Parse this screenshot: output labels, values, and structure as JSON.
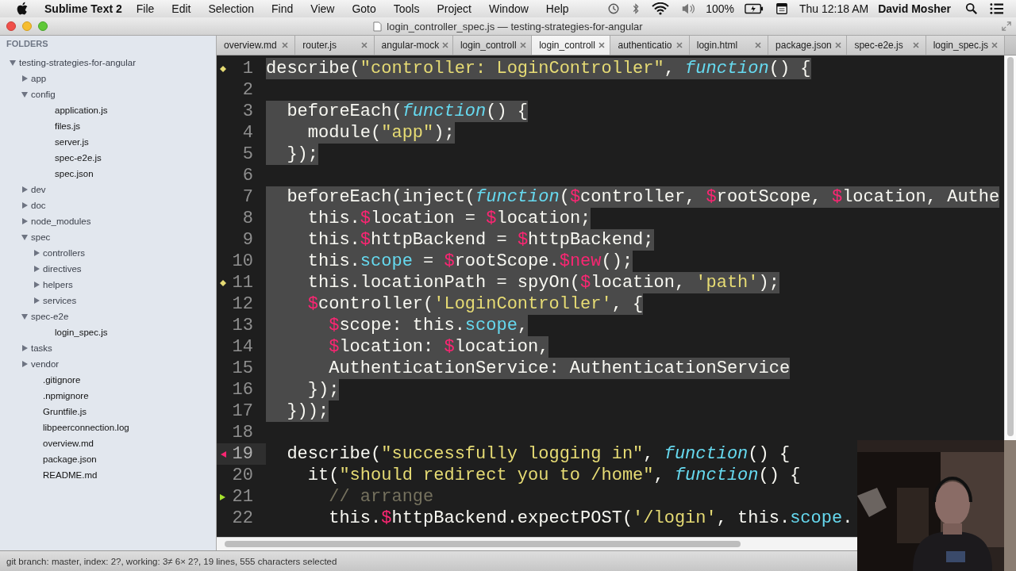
{
  "menubar": {
    "app": "Sublime Text 2",
    "menus": [
      "File",
      "Edit",
      "Selection",
      "Find",
      "View",
      "Goto",
      "Tools",
      "Project",
      "Window",
      "Help"
    ],
    "battery": "100%",
    "clock": "Thu 12:18 AM",
    "user": "David Mosher"
  },
  "window": {
    "title": "login_controller_spec.js — testing-strategies-for-angular"
  },
  "sidebar": {
    "header": "FOLDERS",
    "tree": [
      {
        "label": "testing-strategies-for-angular",
        "kind": "folder",
        "expanded": true,
        "children": [
          {
            "label": "app",
            "kind": "folder",
            "expanded": false
          },
          {
            "label": "config",
            "kind": "folder",
            "expanded": true,
            "children": [
              {
                "label": "application.js",
                "kind": "file"
              },
              {
                "label": "files.js",
                "kind": "file"
              },
              {
                "label": "server.js",
                "kind": "file"
              },
              {
                "label": "spec-e2e.js",
                "kind": "file"
              },
              {
                "label": "spec.json",
                "kind": "file"
              }
            ]
          },
          {
            "label": "dev",
            "kind": "folder",
            "expanded": false
          },
          {
            "label": "doc",
            "kind": "folder",
            "expanded": false
          },
          {
            "label": "node_modules",
            "kind": "folder",
            "expanded": false
          },
          {
            "label": "spec",
            "kind": "folder",
            "expanded": true,
            "children": [
              {
                "label": "controllers",
                "kind": "folder",
                "expanded": false
              },
              {
                "label": "directives",
                "kind": "folder",
                "expanded": false
              },
              {
                "label": "helpers",
                "kind": "folder",
                "expanded": false
              },
              {
                "label": "services",
                "kind": "folder",
                "expanded": false
              }
            ]
          },
          {
            "label": "spec-e2e",
            "kind": "folder",
            "expanded": true,
            "children": [
              {
                "label": "login_spec.js",
                "kind": "file"
              }
            ]
          },
          {
            "label": "tasks",
            "kind": "folder",
            "expanded": false
          },
          {
            "label": "vendor",
            "kind": "folder",
            "expanded": false
          },
          {
            "label": ".gitignore",
            "kind": "file"
          },
          {
            "label": ".npmignore",
            "kind": "file"
          },
          {
            "label": "Gruntfile.js",
            "kind": "file"
          },
          {
            "label": "libpeerconnection.log",
            "kind": "file"
          },
          {
            "label": "overview.md",
            "kind": "file"
          },
          {
            "label": "package.json",
            "kind": "file"
          },
          {
            "label": "README.md",
            "kind": "file"
          }
        ]
      }
    ]
  },
  "tabs": [
    {
      "label": "overview.md",
      "selected": false
    },
    {
      "label": "router.js",
      "selected": false
    },
    {
      "label": "angular-mock",
      "selected": false
    },
    {
      "label": "login_controll",
      "selected": false
    },
    {
      "label": "login_controll",
      "selected": true
    },
    {
      "label": "authenticatio",
      "selected": false
    },
    {
      "label": "login.html",
      "selected": false
    },
    {
      "label": "package.json",
      "selected": false
    },
    {
      "label": "spec-e2e.js",
      "selected": false
    },
    {
      "label": "login_spec.js",
      "selected": false
    }
  ],
  "editor": {
    "lines": [
      {
        "number": "1",
        "marker": {
          "kind": "modified"
        },
        "selected": true,
        "current": false,
        "tokens": [
          {
            "kind": "plain",
            "text": "describe("
          },
          {
            "kind": "str",
            "text": "\"controller: LoginController\""
          },
          {
            "kind": "plain",
            "text": ", "
          },
          {
            "kind": "fn",
            "text": "function"
          },
          {
            "kind": "plain",
            "text": "() {"
          }
        ]
      },
      {
        "number": "2",
        "current": false
      },
      {
        "number": "3",
        "selected": true,
        "current": false,
        "tokens": [
          {
            "kind": "plain",
            "text": "  beforeEach("
          },
          {
            "kind": "fn",
            "text": "function"
          },
          {
            "kind": "plain",
            "text": "() {"
          }
        ]
      },
      {
        "number": "4",
        "selected": true,
        "current": false,
        "tokens": [
          {
            "kind": "plain",
            "text": "    module("
          },
          {
            "kind": "str",
            "text": "\"app\""
          },
          {
            "kind": "plain",
            "text": ");"
          }
        ]
      },
      {
        "number": "5",
        "selected": true,
        "current": false,
        "tokens": [
          {
            "kind": "plain",
            "text": "  });"
          }
        ]
      },
      {
        "number": "6",
        "current": false
      },
      {
        "number": "7",
        "selected": true,
        "current": false,
        "tokens": [
          {
            "kind": "plain",
            "text": "  beforeEach(inject("
          },
          {
            "kind": "fn",
            "text": "function"
          },
          {
            "kind": "plain",
            "text": "("
          },
          {
            "kind": "dollar",
            "text": "$"
          },
          {
            "kind": "plain",
            "text": "controller, "
          },
          {
            "kind": "dollar",
            "text": "$"
          },
          {
            "kind": "plain",
            "text": "rootScope, "
          },
          {
            "kind": "dollar",
            "text": "$"
          },
          {
            "kind": "plain",
            "text": "location, Authe"
          }
        ]
      },
      {
        "number": "8",
        "selected": true,
        "current": false,
        "tokens": [
          {
            "kind": "plain",
            "text": "    this."
          },
          {
            "kind": "dollar",
            "text": "$"
          },
          {
            "kind": "plain",
            "text": "location = "
          },
          {
            "kind": "dollar",
            "text": "$"
          },
          {
            "kind": "plain",
            "text": "location;"
          }
        ]
      },
      {
        "number": "9",
        "selected": true,
        "current": false,
        "tokens": [
          {
            "kind": "plain",
            "text": "    this."
          },
          {
            "kind": "dollar",
            "text": "$"
          },
          {
            "kind": "plain",
            "text": "httpBackend = "
          },
          {
            "kind": "dollar",
            "text": "$"
          },
          {
            "kind": "plain",
            "text": "httpBackend;"
          }
        ]
      },
      {
        "number": "10",
        "selected": true,
        "current": false,
        "tokens": [
          {
            "kind": "plain",
            "text": "    this."
          },
          {
            "kind": "prop",
            "text": "scope"
          },
          {
            "kind": "plain",
            "text": " = "
          },
          {
            "kind": "dollar",
            "text": "$"
          },
          {
            "kind": "plain",
            "text": "rootScope."
          },
          {
            "kind": "dollar",
            "text": "$new"
          },
          {
            "kind": "plain",
            "text": "();"
          }
        ]
      },
      {
        "number": "11",
        "marker": {
          "kind": "modified"
        },
        "selected": true,
        "current": false,
        "tokens": [
          {
            "kind": "plain",
            "text": "    this.locationPath = spyOn("
          },
          {
            "kind": "dollar",
            "text": "$"
          },
          {
            "kind": "plain",
            "text": "location, "
          },
          {
            "kind": "str",
            "text": "'path'"
          },
          {
            "kind": "plain",
            "text": ");"
          }
        ]
      },
      {
        "number": "12",
        "selected": true,
        "current": false,
        "tokens": [
          {
            "kind": "dollar",
            "text": "    $"
          },
          {
            "kind": "plain",
            "text": "controller("
          },
          {
            "kind": "str",
            "text": "'LoginController'"
          },
          {
            "kind": "plain",
            "text": ", {"
          }
        ]
      },
      {
        "number": "13",
        "selected": true,
        "current": false,
        "tokens": [
          {
            "kind": "dollar",
            "text": "      $"
          },
          {
            "kind": "plain",
            "text": "scope: this."
          },
          {
            "kind": "prop",
            "text": "scope"
          },
          {
            "kind": "plain",
            "text": ","
          }
        ]
      },
      {
        "number": "14",
        "selected": true,
        "current": false,
        "tokens": [
          {
            "kind": "dollar",
            "text": "      $"
          },
          {
            "kind": "plain",
            "text": "location: "
          },
          {
            "kind": "dollar",
            "text": "$"
          },
          {
            "kind": "plain",
            "text": "location,"
          }
        ]
      },
      {
        "number": "15",
        "selected": true,
        "current": false,
        "tokens": [
          {
            "kind": "plain",
            "text": "      AuthenticationService: AuthenticationService"
          }
        ]
      },
      {
        "number": "16",
        "selected": true,
        "current": false,
        "tokens": [
          {
            "kind": "plain",
            "text": "    });"
          }
        ]
      },
      {
        "number": "17",
        "selected": true,
        "current": false,
        "tokens": [
          {
            "kind": "plain",
            "text": "  }));"
          }
        ]
      },
      {
        "number": "18",
        "current": false
      },
      {
        "number": "19",
        "marker": {
          "kind": "deleted"
        },
        "selected": false,
        "current": true,
        "tokens": [
          {
            "kind": "plain",
            "text": "  describe("
          },
          {
            "kind": "str",
            "text": "\"successfully logging in\""
          },
          {
            "kind": "plain",
            "text": ", "
          },
          {
            "kind": "fn",
            "text": "function"
          },
          {
            "kind": "plain",
            "text": "() {"
          }
        ]
      },
      {
        "number": "20",
        "selected": false,
        "current": false,
        "tokens": [
          {
            "kind": "plain",
            "text": "    it("
          },
          {
            "kind": "str",
            "text": "\"should redirect you to /home\""
          },
          {
            "kind": "plain",
            "text": ", "
          },
          {
            "kind": "fn",
            "text": "function"
          },
          {
            "kind": "plain",
            "text": "() {"
          }
        ]
      },
      {
        "number": "21",
        "marker": {
          "kind": "added"
        },
        "selected": false,
        "current": false,
        "tokens": [
          {
            "kind": "comment",
            "text": "      // arrange"
          }
        ]
      },
      {
        "number": "22",
        "selected": false,
        "current": false,
        "tokens": [
          {
            "kind": "plain",
            "text": "      this."
          },
          {
            "kind": "dollar",
            "text": "$"
          },
          {
            "kind": "plain",
            "text": "httpBackend.expectPOST("
          },
          {
            "kind": "str",
            "text": "'/login'"
          },
          {
            "kind": "plain",
            "text": ", this."
          },
          {
            "kind": "prop",
            "text": "scope"
          },
          {
            "kind": "plain",
            "text": "."
          }
        ]
      }
    ]
  },
  "status_bar": {
    "text": "git branch: master, index: 2?, working: 3≠ 6× 2?, 19 lines, 555 characters selected"
  }
}
